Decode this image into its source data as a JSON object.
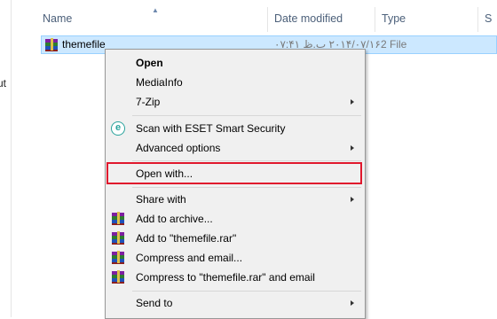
{
  "left_pane": {
    "text_fragment": "ut"
  },
  "header": {
    "columns": {
      "name": "Name",
      "date_modified": "Date modified",
      "type": "Type",
      "size": "S"
    }
  },
  "file_row": {
    "name": "themefile",
    "date_modified": "۲۰۱۴/۰۷/۱۶ ب.ظ ۰۷:۴۱",
    "type": "2 File",
    "icon": "winrar-archive-icon"
  },
  "context_menu": {
    "items": [
      {
        "label": "Open",
        "bold": true
      },
      {
        "label": "MediaInfo"
      },
      {
        "label": "7-Zip",
        "submenu": true
      },
      {
        "label": "Scan with ESET Smart Security",
        "icon": "eset-icon"
      },
      {
        "label": "Advanced options",
        "submenu": true
      },
      {
        "label": "Open with...",
        "highlighted": true
      },
      {
        "label": "Share with",
        "submenu": true
      },
      {
        "label": "Add to archive...",
        "icon": "winrar-archive-icon"
      },
      {
        "label": "Add to \"themefile.rar\"",
        "icon": "winrar-archive-icon"
      },
      {
        "label": "Compress and email...",
        "icon": "winrar-archive-icon"
      },
      {
        "label": "Compress to \"themefile.rar\" and email",
        "icon": "winrar-archive-icon"
      },
      {
        "label": "Send to",
        "submenu": true
      }
    ]
  },
  "colors": {
    "selection": "#cce8ff",
    "selection_border": "#99d1ff",
    "highlight_border": "#e0182d",
    "menu_background": "#f0f0f0",
    "header_text": "#4c607a"
  }
}
